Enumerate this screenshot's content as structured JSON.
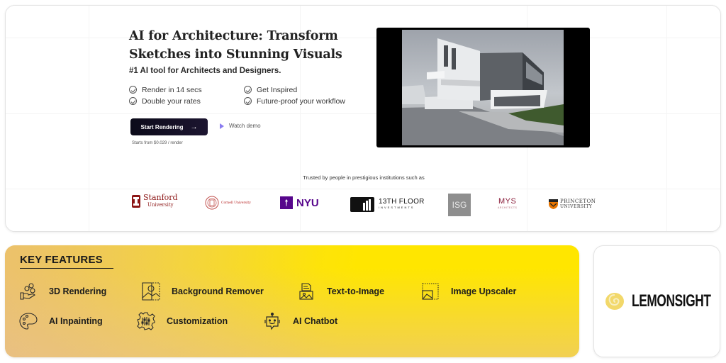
{
  "hero": {
    "headline_line1": "AI for Architecture: Transform",
    "headline_line2": "Sketches into Stunning Visuals",
    "subheadline": "#1 AI tool for Architects and Designers.",
    "benefits": [
      {
        "label": "Render in 14 secs",
        "icon": "check-circle-icon"
      },
      {
        "label": "Get Inspired",
        "icon": "check-circle-icon"
      },
      {
        "label": "Double your rates",
        "icon": "check-circle-icon"
      },
      {
        "label": "Future-proof your workflow",
        "icon": "check-circle-icon"
      }
    ],
    "cta_label": "Start Rendering",
    "cta_icon": "arrow-right-icon",
    "demo_label": "Watch demo",
    "demo_icon": "play-icon",
    "price_note": "Starts from $0.029 / render",
    "video_description": "Modern architecture building render"
  },
  "trusted": {
    "heading": "Trusted by people in prestigious institutions such as",
    "logos": [
      {
        "name": "Stanford",
        "sub": "University",
        "color": "#8c1515"
      },
      {
        "name": "Cornell University",
        "color": "#b31b1b"
      },
      {
        "name": "NYU",
        "color": "#57068c"
      },
      {
        "name": "13TH FLOOR",
        "sub": "INVESTMENTS",
        "color": "#111111"
      },
      {
        "name": "ISG",
        "color": "#8e8e8e"
      },
      {
        "name": "MYS",
        "sub": "ARCHITECTS",
        "color": "#8a1c3a"
      },
      {
        "name": "PRINCETON",
        "sub": "UNIVERSITY",
        "color": "#e77500"
      }
    ]
  },
  "features": {
    "title": "KEY FEATURES",
    "items": [
      {
        "label": "3D Rendering",
        "icon": "hand-cubes-icon"
      },
      {
        "label": "Background Remover",
        "icon": "background-remover-icon"
      },
      {
        "label": "Text-to-Image",
        "icon": "text-to-image-icon"
      },
      {
        "label": "Image Upscaler",
        "icon": "image-upscaler-icon"
      },
      {
        "label": "AI Inpainting",
        "icon": "palette-icon"
      },
      {
        "label": "Customization",
        "icon": "gear-sliders-icon"
      },
      {
        "label": "AI Chatbot",
        "icon": "chatbot-icon"
      }
    ],
    "colors": {
      "start": "#f0c44a",
      "end": "#ffe600"
    }
  },
  "brand": {
    "name": "LEMONSIGHT",
    "logo_icon": "lemon-swirl-icon",
    "color": "#f2d86a"
  }
}
